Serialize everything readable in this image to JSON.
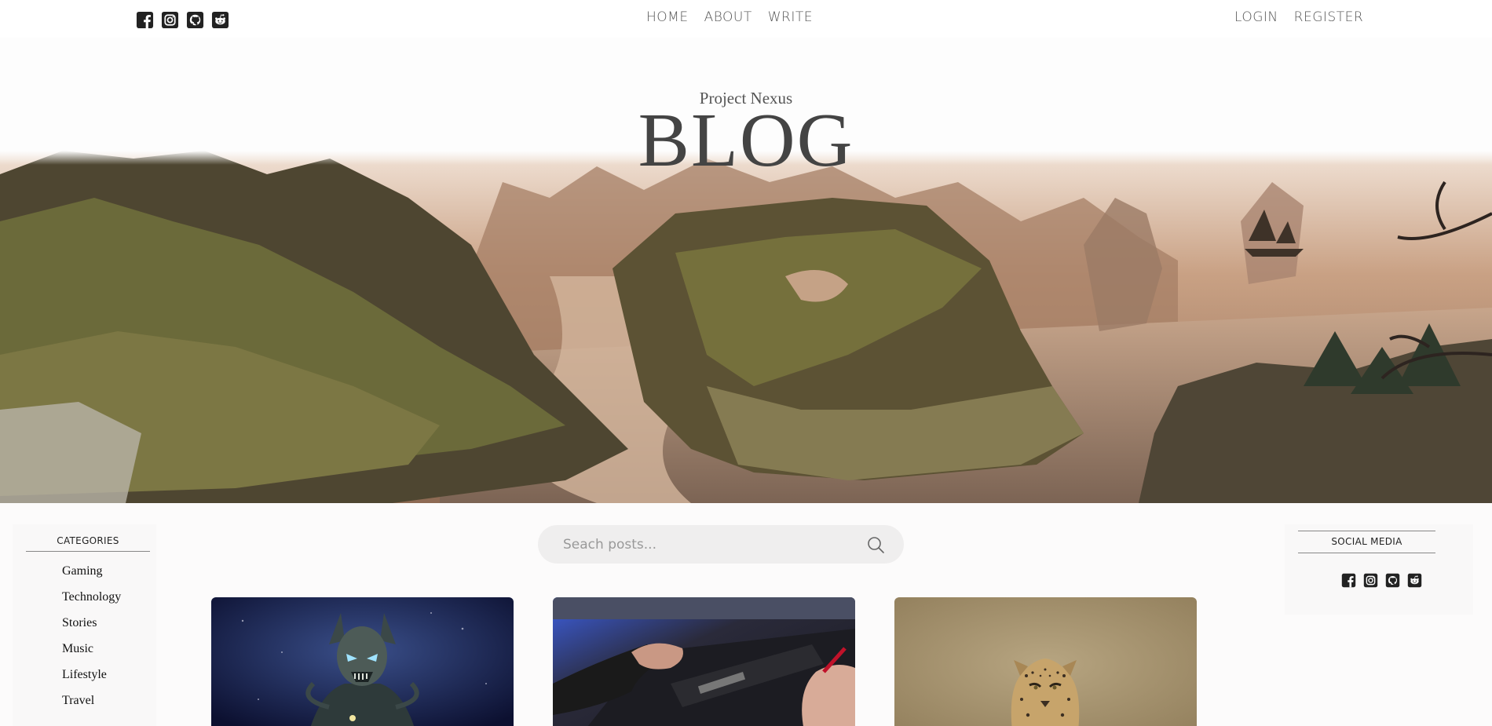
{
  "nav": {
    "social_icons": [
      "facebook-icon",
      "instagram-icon",
      "github-icon",
      "reddit-icon"
    ],
    "links": [
      "HOME",
      "ABOUT",
      "WRITE"
    ],
    "auth": [
      "LOGIN",
      "REGISTER"
    ]
  },
  "header": {
    "subtitle": "Project Nexus",
    "title": "BLOG"
  },
  "search": {
    "placeholder": "Seach posts..."
  },
  "categories": {
    "title": "CATEGORIES",
    "items": [
      "Gaming",
      "Technology",
      "Stories",
      "Music",
      "Lifestyle",
      "Travel"
    ]
  },
  "social_media": {
    "title": "SOCIAL MEDIA",
    "icons": [
      "facebook-icon",
      "instagram-icon",
      "github-icon",
      "reddit-icon"
    ]
  },
  "posts": [
    {
      "image": "demon-warrior-illustration"
    },
    {
      "image": "graphics-card-hands-photo"
    },
    {
      "image": "leopard-photo"
    }
  ],
  "colors": {
    "text": "#555555",
    "search_bg": "#efeeee",
    "panel_bg": "#f9f8f8"
  }
}
